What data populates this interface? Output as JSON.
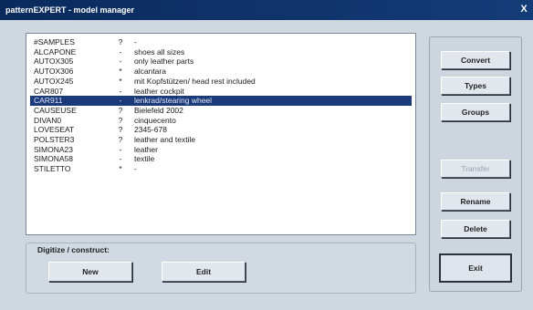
{
  "window": {
    "title": "patternEXPERT - model manager",
    "close_glyph": "X"
  },
  "models": [
    {
      "name": "#SAMPLES",
      "flag": "?",
      "desc": "-"
    },
    {
      "name": "ALCAPONE",
      "flag": "-",
      "desc": "shoes all sizes"
    },
    {
      "name": "AUTOX305",
      "flag": "-",
      "desc": "only leather parts"
    },
    {
      "name": "AUTOX306",
      "flag": "*",
      "desc": "alcantara"
    },
    {
      "name": "AUTOX245",
      "flag": "*",
      "desc": "mit Kopfstützen/ head rest included"
    },
    {
      "name": "CAR807",
      "flag": "-",
      "desc": "leather cockpit"
    },
    {
      "name": "CAR911",
      "flag": "-",
      "desc": "lenkrad/stearing wheel",
      "selected": true
    },
    {
      "name": "CAUSEUSE",
      "flag": "?",
      "desc": "Bielefeld 2002"
    },
    {
      "name": "DIVAN0",
      "flag": "?",
      "desc": "cinquecento"
    },
    {
      "name": "LOVESEAT",
      "flag": "?",
      "desc": "2345-678"
    },
    {
      "name": "POLSTER3",
      "flag": "?",
      "desc": "leather and textile"
    },
    {
      "name": "SIMONA23",
      "flag": "-",
      "desc": "leather"
    },
    {
      "name": "SIMONA58",
      "flag": "-",
      "desc": "textile"
    },
    {
      "name": "STILETTO",
      "flag": "*",
      "desc": "-"
    }
  ],
  "digitize": {
    "label": "Digitize / construct:",
    "new_label": "New",
    "edit_label": "Edit"
  },
  "actions": {
    "convert": "Convert",
    "types": "Types",
    "groups": "Groups",
    "transfer": "Transfer",
    "rename": "Rename",
    "delete": "Delete",
    "exit": "Exit"
  }
}
